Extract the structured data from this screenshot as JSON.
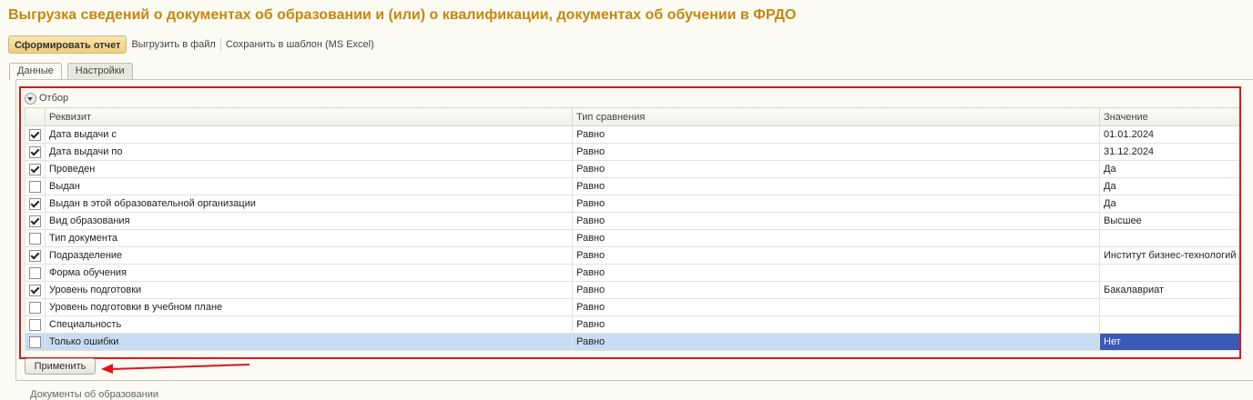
{
  "title": "Выгрузка сведений о документах об образовании и (или) о квалификации, документах об обучении в ФРДО",
  "toolbar": {
    "generate_label": "Сформировать отчет",
    "export_file_label": "Выгрузить в файл",
    "save_template_label": "Сохранить в шаблон (MS Excel)"
  },
  "tabs": [
    {
      "label": "Данные",
      "active": true
    },
    {
      "label": "Настройки",
      "active": false
    }
  ],
  "filter": {
    "title": "Отбор",
    "columns": [
      "Реквизит",
      "Тип сравнения",
      "Значение"
    ],
    "rows": [
      {
        "checked": true,
        "field": "Дата выдачи с",
        "comparison": "Равно",
        "value": "01.01.2024"
      },
      {
        "checked": true,
        "field": "Дата выдачи по",
        "comparison": "Равно",
        "value": "31.12.2024"
      },
      {
        "checked": true,
        "field": "Проведен",
        "comparison": "Равно",
        "value": "Да"
      },
      {
        "checked": false,
        "field": "Выдан",
        "comparison": "Равно",
        "value": "Да"
      },
      {
        "checked": true,
        "field": "Выдан в этой образовательной организации",
        "comparison": "Равно",
        "value": "Да"
      },
      {
        "checked": true,
        "field": "Вид образования",
        "comparison": "Равно",
        "value": "Высшее"
      },
      {
        "checked": false,
        "field": "Тип документа",
        "comparison": "Равно",
        "value": ""
      },
      {
        "checked": true,
        "field": "Подразделение",
        "comparison": "Равно",
        "value": "Институт бизнес-технологий"
      },
      {
        "checked": false,
        "field": "Форма обучения",
        "comparison": "Равно",
        "value": ""
      },
      {
        "checked": true,
        "field": "Уровень подготовки",
        "comparison": "Равно",
        "value": "Бакалавриат"
      },
      {
        "checked": false,
        "field": "Уровень подготовки в учебном плане",
        "comparison": "Равно",
        "value": ""
      },
      {
        "checked": false,
        "field": "Специальность",
        "comparison": "Равно",
        "value": ""
      },
      {
        "checked": false,
        "field": "Только ошибки",
        "comparison": "Равно",
        "value": "Нет",
        "selected": true
      }
    ]
  },
  "apply_label": "Применить",
  "bottom_text": "Документы об образовании",
  "colors": {
    "title": "#c8860a",
    "highlight": "#e0151b",
    "selected_row": "#c8dcf3",
    "current_cell": "#3b59b6"
  }
}
